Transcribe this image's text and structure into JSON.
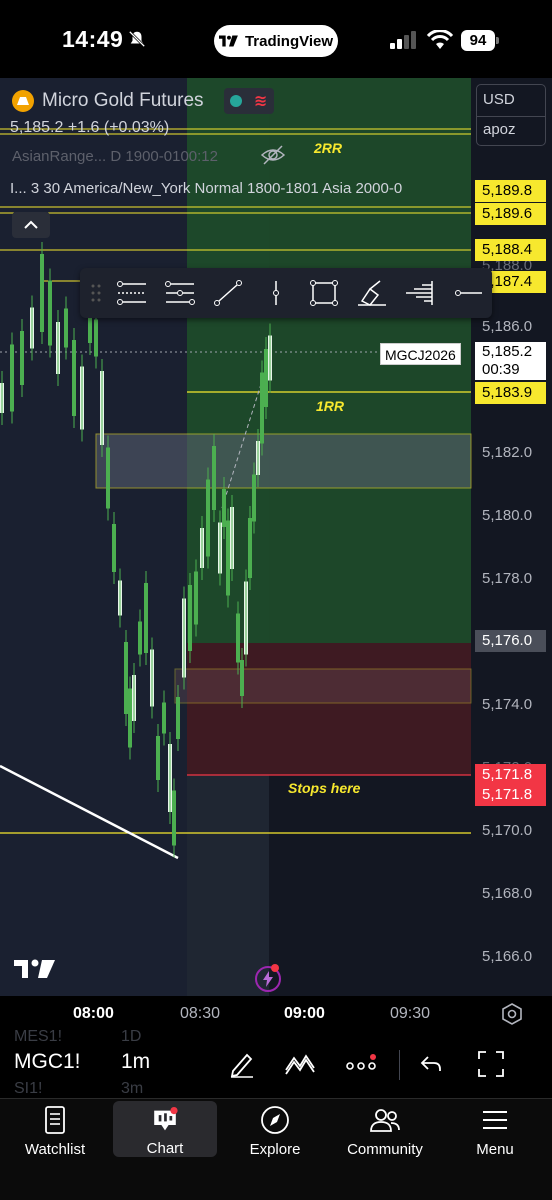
{
  "status_bar": {
    "time": "14:49",
    "app_pill": "TradingView",
    "battery": "94"
  },
  "symbol": {
    "name": "Micro Gold Futures",
    "price_line": "5,185.2 +1.6 (+0.03%)",
    "indicator1": "AsianRange... D 1900-0100:12",
    "indicator2": "I... 3 30 America/New_York Normal 1800-1801 Asia 2000-0"
  },
  "currency": {
    "currency": "USD",
    "unit": "apoz"
  },
  "price_axis": {
    "labels": [
      "5,186.0",
      "5,182.0",
      "5,180.0",
      "5,178.0",
      "5,174.0",
      "5,170.0",
      "5,168.0",
      "5,166.0"
    ],
    "partial_label": "5,188.0",
    "faint_label": "5,172.0",
    "tags": {
      "t1": "5,189.8",
      "t2": "5,189.6",
      "t3": "5,188.4",
      "t4": "5,187.4",
      "t5": "5,183.9",
      "t6": "5,176.0",
      "t7": "5,171.8",
      "t8": "5,171.8"
    },
    "current_price": "5,185.2",
    "countdown": "00:39",
    "ticker": "MGCJ2026"
  },
  "annotations": {
    "rr2": "2RR",
    "rr1": "1RR",
    "stops": "Stops here"
  },
  "drawing_toolbar": [
    "horizontal-lines-icon",
    "parallel-channel-icon",
    "trend-line-icon",
    "vertical-line-icon",
    "rectangle-icon",
    "brush-icon",
    "volume-profile-icon",
    "horizontal-ray-icon"
  ],
  "time_axis": {
    "labels": [
      "08:00",
      "08:30",
      "09:00",
      "09:30"
    ]
  },
  "bottom_toolbar": {
    "symbol": "MGC1!",
    "interval": "1m",
    "ghost_symbols": [
      "MES1!",
      "SI1!"
    ],
    "ghost_intervals": [
      "1D",
      "3m"
    ]
  },
  "nav": {
    "items": [
      "Watchlist",
      "Chart",
      "Explore",
      "Community",
      "Menu"
    ]
  },
  "colors": {
    "background": "#131722",
    "accent_yellow": "#f7e82e",
    "stop_red": "#f23645",
    "profit_green": "#26a69a",
    "candle_green": "#4caf50"
  }
}
